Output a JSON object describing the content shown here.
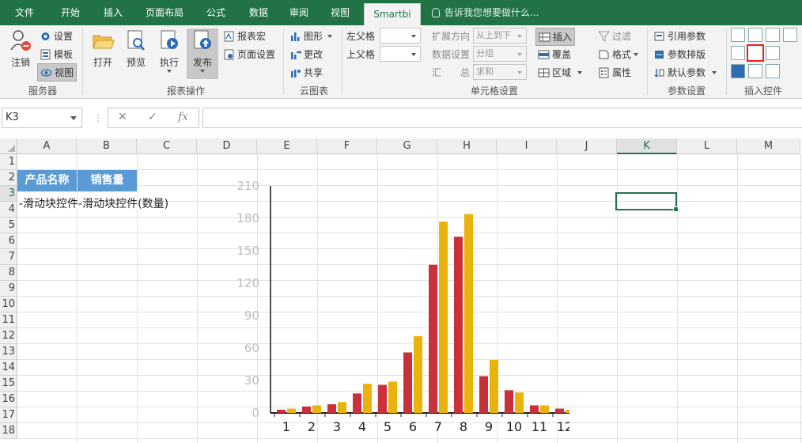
{
  "tabs": [
    "文件",
    "开始",
    "插入",
    "页面布局",
    "公式",
    "数据",
    "审阅",
    "视图",
    "Smartbi"
  ],
  "active_tab": "Smartbi",
  "tell_me": "告诉我您想要做什么...",
  "ribbon": {
    "server": {
      "logout": "注销",
      "settings": "设置",
      "template": "模板",
      "view": "视图",
      "group": "服务器"
    },
    "report_ops": {
      "open": "打开",
      "preview": "预览",
      "execute": "执行",
      "publish": "发布",
      "macro": "报表宏",
      "page_setup": "页面设置",
      "group": "报表操作"
    },
    "cloud_chart": {
      "chart": "图形",
      "change": "更改",
      "share": "共享",
      "group": "云图表"
    },
    "cell_settings": {
      "left_parent": "左父格",
      "top_parent": "上父格",
      "expand_dir_label": "扩展方向",
      "expand_dir_value": "从上到下",
      "data_setting_label": "数据设置",
      "data_setting_value": "分组",
      "summary_label_a": "汇",
      "summary_label_b": "总",
      "summary_value": "求和",
      "insert": "插入",
      "cover": "覆盖",
      "region": "区域",
      "filter": "过滤",
      "format": "格式",
      "attribute": "属性",
      "group": "单元格设置"
    },
    "params": {
      "ref_param": "引用参数",
      "param_layout": "参数排版",
      "default_param": "默认参数",
      "group": "参数设置"
    },
    "insert_controls": {
      "group": "插入控件"
    }
  },
  "formula_bar": {
    "name_box": "K3",
    "formula": ""
  },
  "columns": [
    "A",
    "B",
    "C",
    "D",
    "E",
    "F",
    "G",
    "H",
    "I",
    "J",
    "K",
    "L",
    "M"
  ],
  "selected_column": "K",
  "selected_row": "3",
  "rows": [
    "1",
    "2",
    "3",
    "4",
    "5",
    "6",
    "7",
    "8",
    "9",
    "10",
    "11",
    "12",
    "13",
    "14",
    "15",
    "16",
    "17",
    "18"
  ],
  "cells": {
    "A2": "产品名称",
    "B2": "销售量",
    "A3": "-滑动块控件-滑动块控件(数量)"
  },
  "chart_data": {
    "type": "bar",
    "categories": [
      "1",
      "2",
      "3",
      "4",
      "5",
      "6",
      "7",
      "8",
      "9",
      "10",
      "11",
      "12"
    ],
    "series": [
      {
        "values": [
          3,
          6,
          8,
          18,
          26,
          56,
          137,
          163,
          34,
          21,
          7,
          4
        ]
      },
      {
        "values": [
          4,
          7,
          10,
          27,
          29,
          71,
          177,
          184,
          49,
          19,
          7,
          3
        ]
      }
    ],
    "colors": [
      "#c8313a",
      "#eab30c"
    ],
    "ylim": [
      0,
      210
    ],
    "yticks": [
      0,
      30,
      60,
      90,
      120,
      150,
      180,
      210
    ],
    "grid": false,
    "legend": "none"
  }
}
